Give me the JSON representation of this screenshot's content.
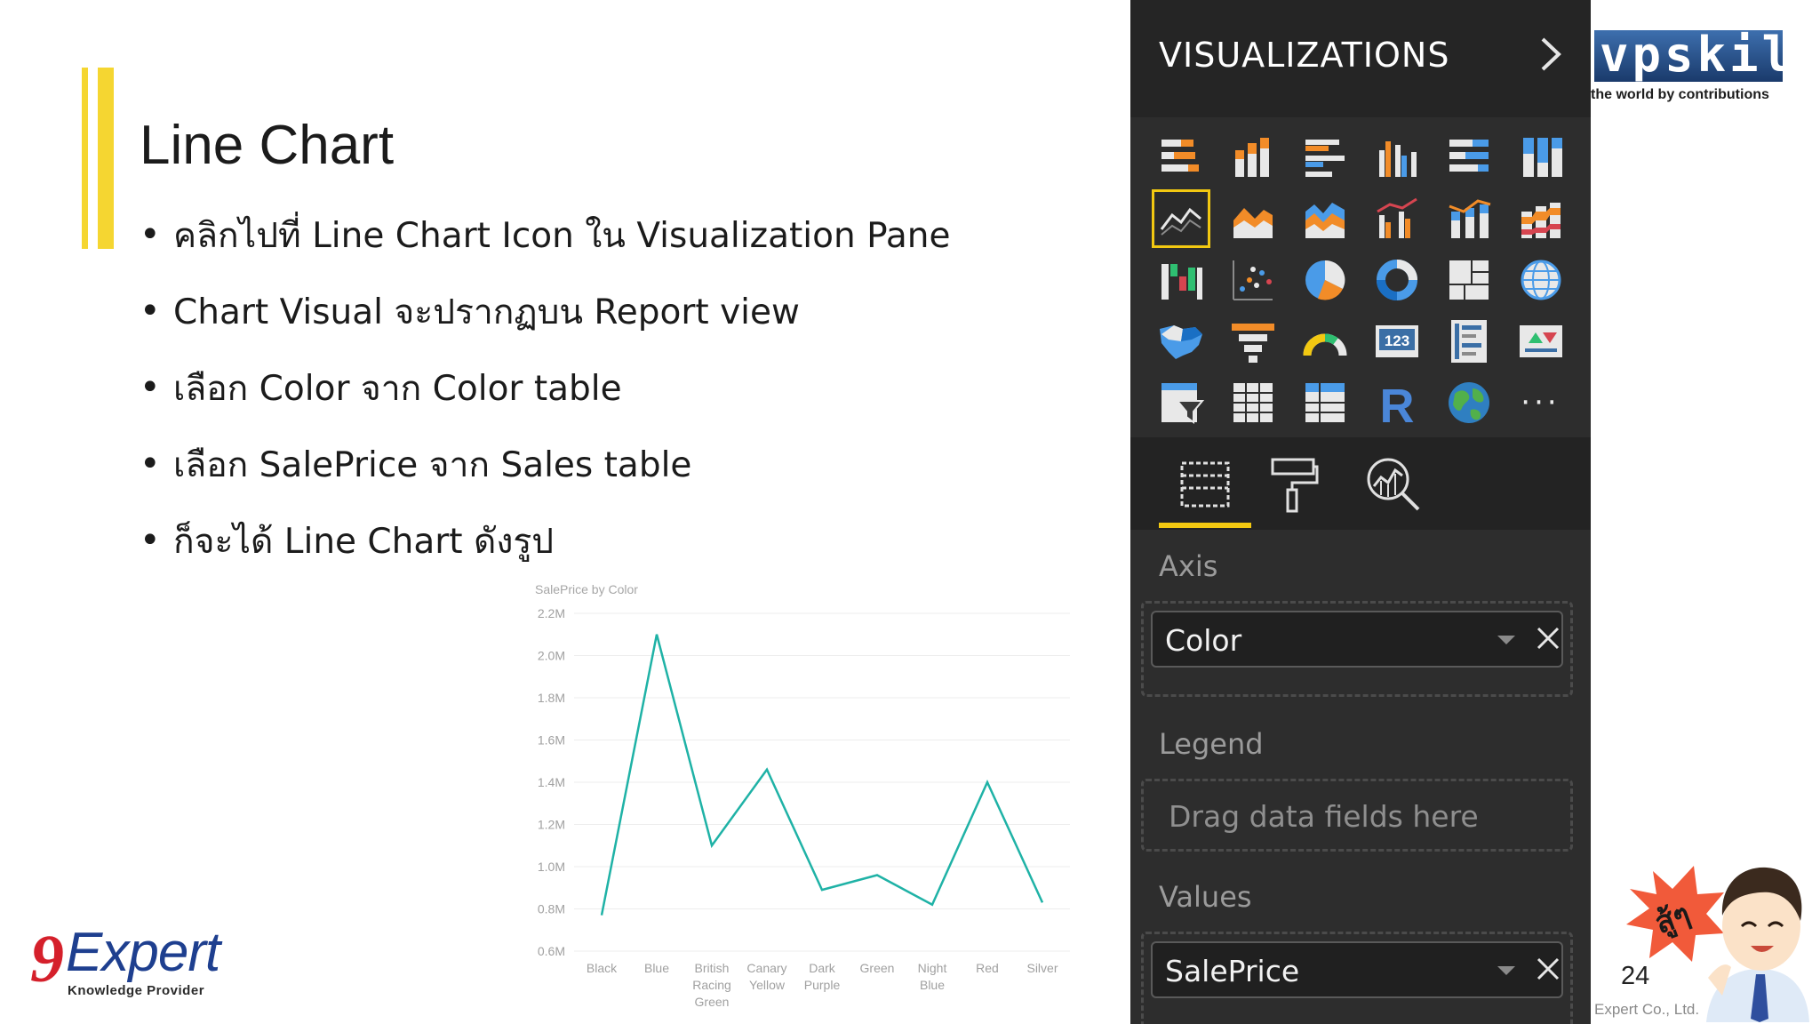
{
  "slide": {
    "title": "Line Chart",
    "bullets": [
      "คลิกไปที่ Line Chart Icon ใน Visualization Pane",
      "Chart Visual จะปรากฏบน Report view",
      "เลือก Color จาก Color table",
      "เลือก SalePrice จาก Sales table",
      "ก็จะได้ Line Chart ดังรูป"
    ],
    "page_number": "24",
    "copyright": "Expert Co., Ltd."
  },
  "logos": {
    "nine": "9",
    "expert": "Expert",
    "knowledge_provider": "Knowledge Provider",
    "vpskill": "vpskill",
    "vpskill_tagline": "the world by contributions",
    "mascot_text": "สู้ๆ"
  },
  "pane": {
    "title": "VISUALIZATIONS",
    "icons": [
      "stacked-bar-icon",
      "stacked-column-icon",
      "clustered-bar-icon",
      "clustered-column-icon",
      "100-stacked-bar-icon",
      "100-stacked-column-icon",
      "line-chart-icon",
      "area-chart-icon",
      "stacked-area-icon",
      "line-clustered-column-icon",
      "line-stacked-column-icon",
      "ribbon-chart-icon",
      "waterfall-icon",
      "scatter-icon",
      "pie-icon",
      "donut-icon",
      "treemap-icon",
      "map-icon",
      "filled-map-icon",
      "funnel-icon",
      "gauge-icon",
      "card-icon",
      "multi-row-card-icon",
      "kpi-icon",
      "slicer-icon",
      "table-icon",
      "matrix-icon",
      "r-visual-icon",
      "arcgis-globe-icon",
      "more-icon"
    ],
    "selected_icon": "line-chart-icon",
    "r_label": "R",
    "card_label": "123",
    "more_label": "···",
    "tabs": [
      "fields-tab",
      "format-tab",
      "analytics-tab"
    ],
    "axis_label": "Axis",
    "axis_field": "Color",
    "legend_label": "Legend",
    "legend_placeholder": "Drag data fields here",
    "values_label": "Values",
    "values_field": "SalePrice",
    "accent_color": "#f2c811"
  },
  "chart_data": {
    "type": "line",
    "title": "SalePrice by Color",
    "categories": [
      "Black",
      "Blue",
      "British Racing Green",
      "Canary Yellow",
      "Dark Purple",
      "Green",
      "Night Blue",
      "Red",
      "Silver"
    ],
    "category_lines": [
      [
        "Black"
      ],
      [
        "Blue"
      ],
      [
        "British",
        "Racing",
        "Green"
      ],
      [
        "Canary",
        "Yellow"
      ],
      [
        "Dark",
        "Purple"
      ],
      [
        "Green"
      ],
      [
        "Night",
        "Blue"
      ],
      [
        "Red"
      ],
      [
        "Silver"
      ]
    ],
    "values": [
      0.77,
      2.1,
      1.1,
      1.46,
      0.89,
      0.96,
      0.82,
      1.4,
      0.83
    ],
    "ylim": [
      0.6,
      2.2
    ],
    "yticks": [
      0.6,
      0.8,
      1.0,
      1.2,
      1.4,
      1.6,
      1.8,
      2.0,
      2.2
    ],
    "ytick_labels": [
      "0.6M",
      "0.8M",
      "1.0M",
      "1.2M",
      "1.4M",
      "1.6M",
      "1.8M",
      "2.0M",
      "2.2M"
    ],
    "line_color": "#1fb2a6",
    "grid": true
  }
}
